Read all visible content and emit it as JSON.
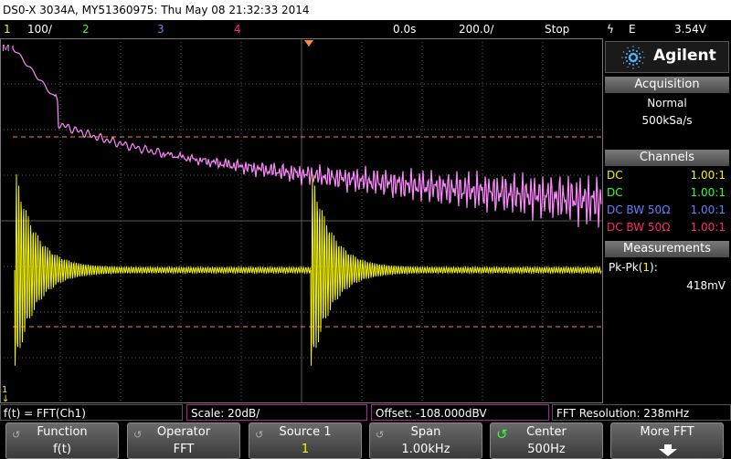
{
  "title_bar": "DS0-X 3034A, MY51360975: Thu May 08 21:32:33 2014",
  "status_bar": {
    "ch1_num": "1",
    "ch1_scale": "100∕",
    "ch2_num": "2",
    "ch3_num": "3",
    "ch4_num": "4",
    "time_delay": "0.0s",
    "time_scale": "200.0∕",
    "run_state": "Stop",
    "trigger_icon": "ϟ",
    "trigger_source": "E",
    "trigger_level": "3.54V"
  },
  "markers": {
    "math_marker": "M",
    "ch1_marker": "1",
    "ch1_marker_arrow": "↓"
  },
  "brand": {
    "name": "Agilent"
  },
  "acquisition": {
    "header": "Acquisition",
    "mode": "Normal",
    "rate": "500kSa/s"
  },
  "channels": {
    "header": "Channels",
    "rows": [
      {
        "coupling": "DC",
        "ratio": "1.00:1",
        "color": "#f5f500"
      },
      {
        "coupling": "DC",
        "ratio": "1.00:1",
        "color": "#33ff33"
      },
      {
        "coupling": "DC BW 50Ω",
        "ratio": "1.00:1",
        "color": "#6a7fff"
      },
      {
        "coupling": "DC BW 50Ω",
        "ratio": "1.00:1",
        "color": "#ff2a6a"
      }
    ]
  },
  "measurements": {
    "header": "Measurements",
    "label": "Pk-Pk(",
    "label_ch": "1",
    "label_end": "):",
    "value": "418mV"
  },
  "bottom_info": {
    "function": "f(t) = FFT(Ch1)",
    "scale": "Scale: 20dB/",
    "offset": "Offset: -108.000dBV",
    "resolution": "FFT Resolution: 238mHz"
  },
  "softkeys": [
    {
      "top": "Function",
      "bottom": "f(t)",
      "knob": "↺"
    },
    {
      "top": "Operator",
      "bottom": "FFT",
      "knob": "↺"
    },
    {
      "top": "Source 1",
      "bottom": "1",
      "knob": "↺"
    },
    {
      "top": "Span",
      "bottom": "1.00kHz",
      "knob": "↺"
    },
    {
      "top": "Center",
      "bottom": "500Hz",
      "knob": "↺"
    },
    {
      "top": "More FFT",
      "bottom": "",
      "knob": ""
    }
  ],
  "colors": {
    "ch1": "#f5f500",
    "ch2": "#33ff33",
    "ch3": "#6a7fff",
    "ch4": "#ff2a6a",
    "math": "#ff88ff",
    "cursor": "#ff8a33",
    "grid": "#5a5a5a"
  }
}
